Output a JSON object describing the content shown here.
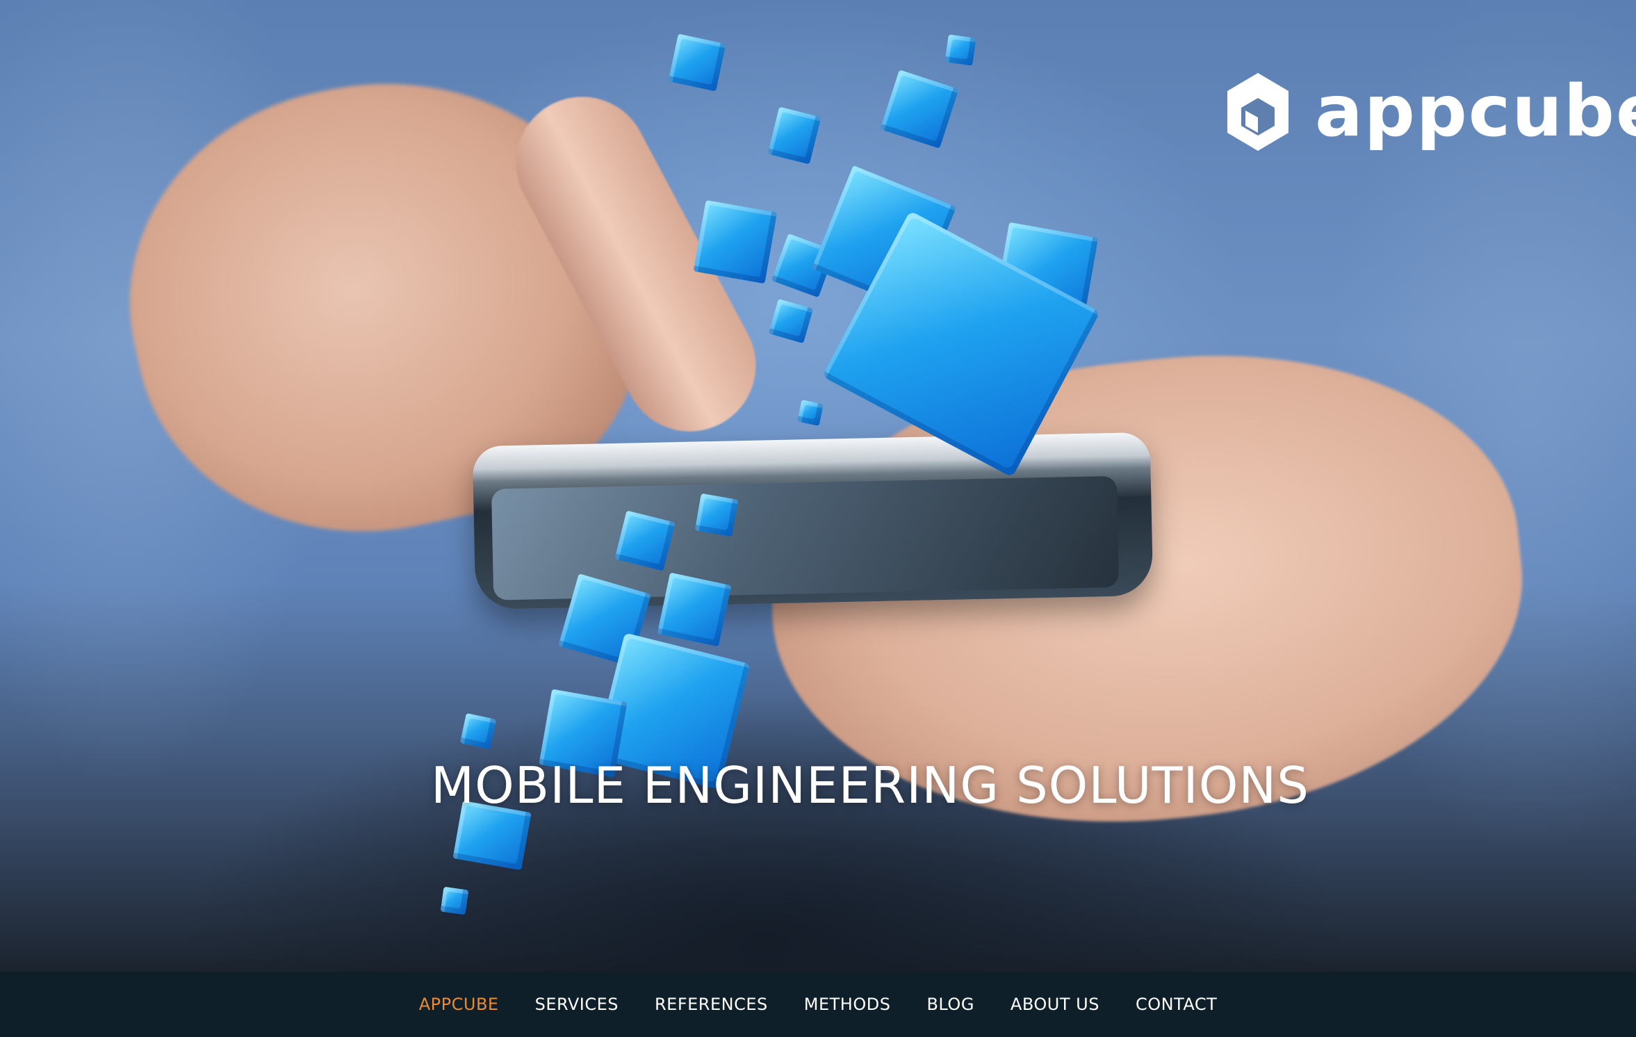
{
  "logo": {
    "text": "appcube",
    "icon": "hexagon-cube-icon"
  },
  "hero": {
    "headline": "MOBILE ENGINEERING SOLUTIONS"
  },
  "nav": {
    "items": [
      {
        "label": "APPCUBE",
        "active": true
      },
      {
        "label": "SERVICES",
        "active": false
      },
      {
        "label": "REFERENCES",
        "active": false
      },
      {
        "label": "METHODS",
        "active": false
      },
      {
        "label": "BLOG",
        "active": false
      },
      {
        "label": "ABOUT US",
        "active": false
      },
      {
        "label": "CONTACT",
        "active": false
      }
    ]
  },
  "colors": {
    "nav_background": "#0e1f29",
    "nav_active": "#ee8a2e",
    "nav_text": "#ffffff",
    "cube_accent": "#1fa2f0"
  }
}
